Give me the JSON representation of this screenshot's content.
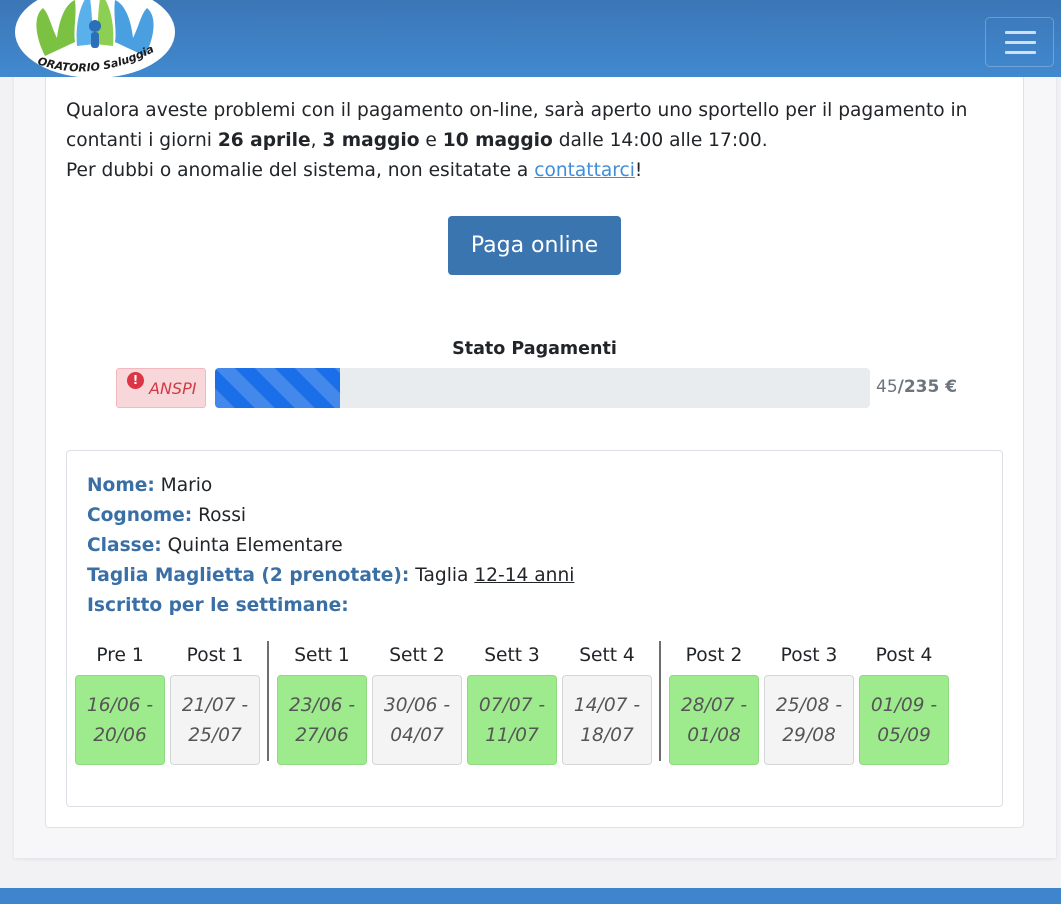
{
  "header": {
    "logo_text": "ORATORIO Saluggia",
    "menu_icon": "hamburger-icon"
  },
  "intro": {
    "line1": "Qualora aveste problemi con il pagamento on-line, sarà aperto uno sportello per il pagamento in",
    "line2_a": "contanti i giorni ",
    "date1": "26 aprile",
    "sep1": ", ",
    "date2": "3 maggio",
    "sep2": " e ",
    "date3": "10 maggio",
    "line2_b": " dalle 14:00 alle 17:00.",
    "line3_a": "Per dubbi o anomalie del sistema, non esitatate a ",
    "contact_link": "contattarci",
    "line3_b": "!"
  },
  "pay_button": "Paga online",
  "status": {
    "title": "Stato Pagamenti",
    "badge_label": "ANSPI",
    "badge_icon": "exclamation-circle-icon",
    "paid": "45",
    "total": "/235 €",
    "progress_fraction": 0.191,
    "colors": {
      "bar": "#1a6fe8",
      "badge_bg": "#f8d7da",
      "badge_text": "#cf3a45"
    }
  },
  "person": {
    "name_label": "Nome:",
    "name": " Mario",
    "surname_label": "Cognome:",
    "surname": " Rossi",
    "class_label": "Classe:",
    "class": " Quinta Elementare",
    "shirt_label": "Taglia Maglietta (2 prenotate):",
    "shirt_prefix": " Taglia ",
    "shirt_size": "12-14 anni",
    "weeks_label": "Iscritto per le settimane:"
  },
  "weeks": [
    {
      "label": "Pre 1",
      "line1": "16/06 -",
      "line2": "20/06",
      "enrolled": true
    },
    {
      "label": "Post 1",
      "line1": "21/07 -",
      "line2": "25/07",
      "enrolled": false
    },
    {
      "label": "Sett 1",
      "line1": "23/06 -",
      "line2": "27/06",
      "enrolled": true
    },
    {
      "label": "Sett 2",
      "line1": "30/06 -",
      "line2": "04/07",
      "enrolled": false
    },
    {
      "label": "Sett 3",
      "line1": "07/07 -",
      "line2": "11/07",
      "enrolled": true
    },
    {
      "label": "Sett 4",
      "line1": "14/07 -",
      "line2": "18/07",
      "enrolled": false
    },
    {
      "label": "Post 2",
      "line1": "28/07 -",
      "line2": "01/08",
      "enrolled": true
    },
    {
      "label": "Post 3",
      "line1": "25/08 -",
      "line2": "29/08",
      "enrolled": false
    },
    {
      "label": "Post 4",
      "line1": "01/09 -",
      "line2": "05/09",
      "enrolled": true
    }
  ]
}
